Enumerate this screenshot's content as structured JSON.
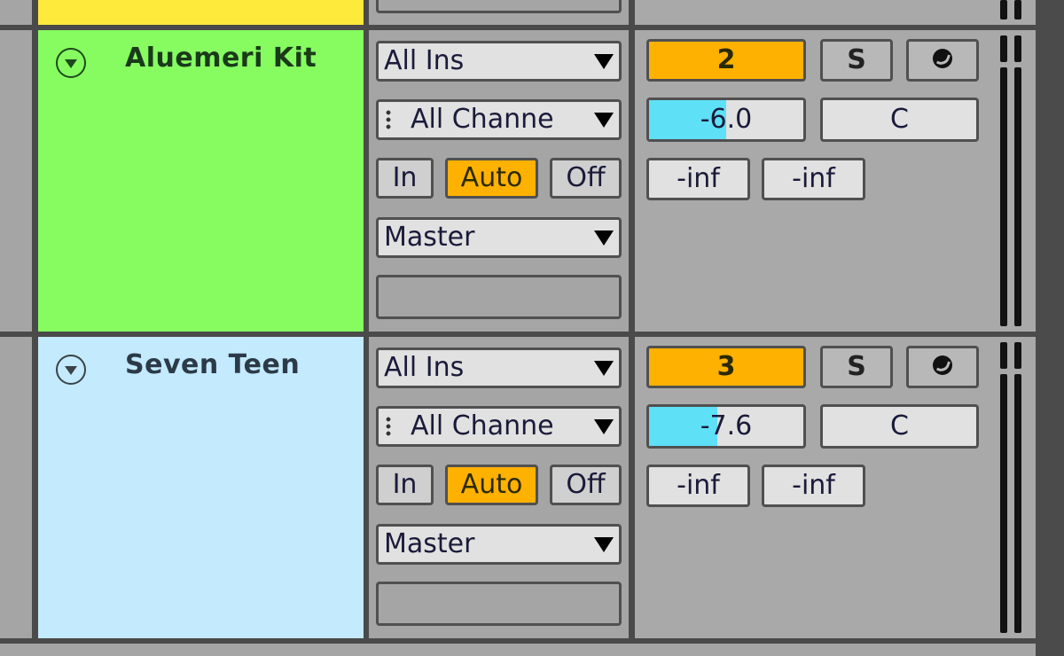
{
  "colors": {
    "prev_track": "#fdea3a",
    "track1": "#86fc61",
    "track2": "#c3eafd",
    "arm_active": "#ffb100",
    "volume_fill": "#5ee0f7"
  },
  "tracks": [
    {
      "name": "Aluemeri Kit",
      "fold_icon": "fold-triangle-icon",
      "input_type": "All Ins",
      "input_channel": "All Channe",
      "monitor": {
        "in": "In",
        "auto": "Auto",
        "off": "Off",
        "selected": "Auto"
      },
      "output": "Master",
      "track_number": "2",
      "solo": "S",
      "arm_icon": "record-arm-icon",
      "volume": "-6.0",
      "volume_fraction": 0.5,
      "pan": "C",
      "send_a": "-inf",
      "send_b": "-inf"
    },
    {
      "name": "Seven Teen",
      "fold_icon": "fold-triangle-icon",
      "input_type": "All Ins",
      "input_channel": "All Channe",
      "monitor": {
        "in": "In",
        "auto": "Auto",
        "off": "Off",
        "selected": "Auto"
      },
      "output": "Master",
      "track_number": "3",
      "solo": "S",
      "arm_icon": "record-arm-icon",
      "volume": "-7.6",
      "volume_fraction": 0.44,
      "pan": "C",
      "send_a": "-inf",
      "send_b": "-inf"
    }
  ]
}
